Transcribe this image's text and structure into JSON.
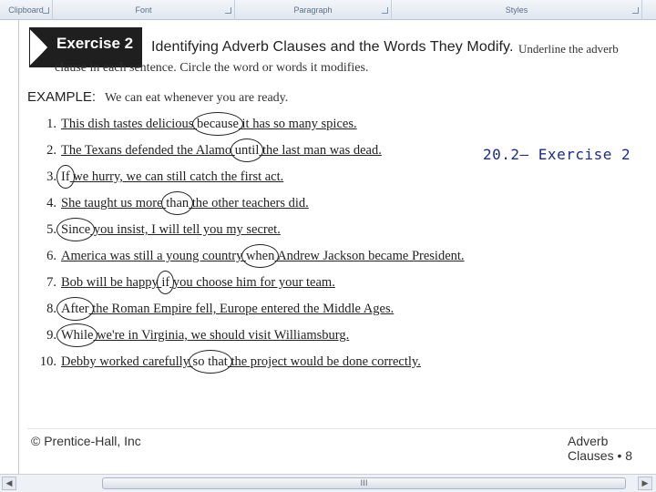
{
  "ribbon": {
    "groups": [
      {
        "label": "Clipboard"
      },
      {
        "label": "Font"
      },
      {
        "label": "Paragraph"
      },
      {
        "label": "Styles"
      }
    ]
  },
  "exercise": {
    "badge": "Exercise 2",
    "heading": "Identifying Adverb Clauses and the Words They Modify.",
    "instruction_part1": "Underline the adverb",
    "instruction_part2": "clause in each sentence. Circle the word or words it modifies.",
    "example_tag": "EXAMPLE:",
    "example_text": "We can eat whenever you are ready."
  },
  "sentences": [
    {
      "num": "1.",
      "a": "This dish tastes delicious ",
      "b": "because",
      "c": " it has so many spices."
    },
    {
      "num": "2.",
      "a": "The Texans defended the Alamo ",
      "b": "until",
      "c": " the last man was dead."
    },
    {
      "num": "3.",
      "a": "",
      "b": "If",
      "c": " we hurry, we can still catch the first act."
    },
    {
      "num": "4.",
      "a": "She taught us more ",
      "b": "than",
      "c": " the other teachers did."
    },
    {
      "num": "5.",
      "a": "",
      "b": "Since",
      "c": " you insist, I will tell you my secret."
    },
    {
      "num": "6.",
      "a": "America was still a young country ",
      "b": "when",
      "c": " Andrew Jackson became President."
    },
    {
      "num": "7.",
      "a": "Bob will be happy ",
      "b": "if",
      "c": " you choose him for your team."
    },
    {
      "num": "8.",
      "a": "",
      "b": "After",
      "c": " the Roman Empire fell, Europe entered the Middle Ages."
    },
    {
      "num": "9.",
      "a": "",
      "b": "While",
      "c": " we're in Virginia, we should visit Williamsburg."
    },
    {
      "num": "10.",
      "a": "Debby worked carefully ",
      "b": "so that",
      "c": " the project would be done correctly."
    }
  ],
  "overlay_title": "20.2– Exercise 2",
  "footer": {
    "left": "© Prentice-Hall, Inc",
    "right": "Adverb Clauses • 8"
  },
  "scrollbar": {
    "thumb_grip": "III"
  }
}
